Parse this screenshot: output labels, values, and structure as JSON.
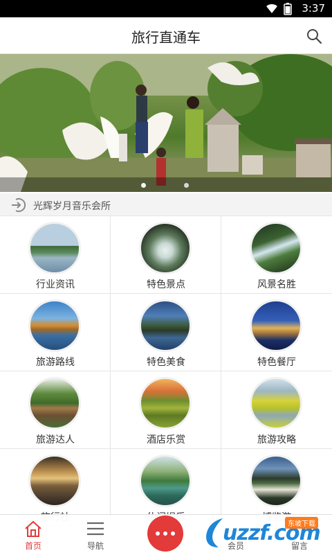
{
  "status_bar": {
    "time": "3:37"
  },
  "header": {
    "title": "旅行直通车"
  },
  "banner": {
    "slide_count": 2,
    "active_slide": 1
  },
  "notice": {
    "text": "光辉岁月音乐会所"
  },
  "grid": [
    {
      "label": "行业资讯",
      "icon": "lake-pier-photo"
    },
    {
      "label": "特色景点",
      "icon": "waterfall-rocks-photo"
    },
    {
      "label": "风景名胜",
      "icon": "forest-path-photo"
    },
    {
      "label": "旅游路线",
      "icon": "autumn-lake-photo"
    },
    {
      "label": "特色美食",
      "icon": "pagoda-lake-photo"
    },
    {
      "label": "特色餐厅",
      "icon": "castle-night-photo"
    },
    {
      "label": "旅游达人",
      "icon": "camping-tent-photo"
    },
    {
      "label": "酒店乐赏",
      "icon": "terraced-fields-photo"
    },
    {
      "label": "旅游攻略",
      "icon": "river-flowers-photo"
    },
    {
      "label": "旅行社",
      "icon": "sunset-lake-photo"
    },
    {
      "label": "休闲娱乐",
      "icon": "green-river-photo"
    },
    {
      "label": "博览游",
      "icon": "mountain-river-photo"
    }
  ],
  "tabbar": {
    "home": "首页",
    "nav": "导航",
    "member": "会员",
    "message": "留言"
  },
  "watermark": {
    "text": "uzzf.com",
    "badge": "东坡下载"
  },
  "colors": {
    "accent": "#e33a3a",
    "watermark": "#1e86d8"
  }
}
